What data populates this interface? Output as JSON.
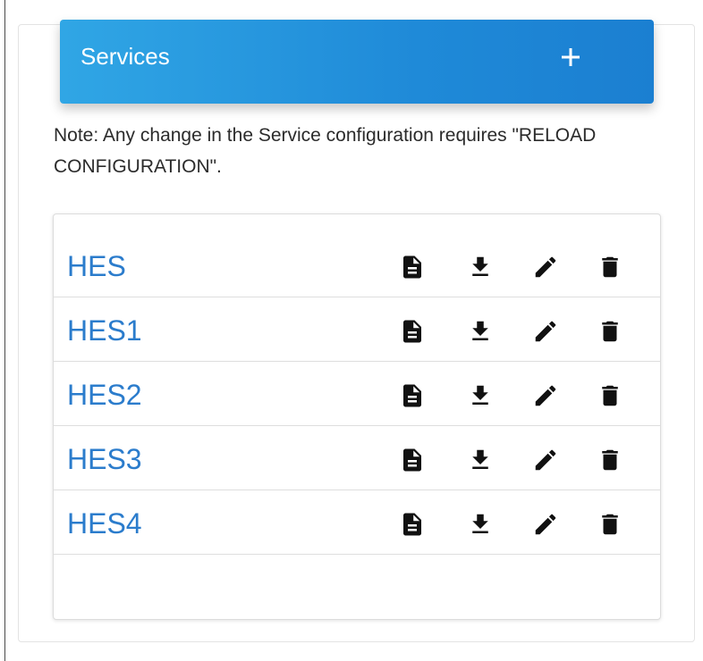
{
  "header": {
    "title": "Services",
    "add_icon": "plus-icon",
    "background": "#1f8ad8"
  },
  "note": {
    "text": "Note: Any change in the Service configuration requires \"RELOAD CONFIGURATION\"."
  },
  "services": [
    {
      "name": "HES"
    },
    {
      "name": "HES1"
    },
    {
      "name": "HES2"
    },
    {
      "name": "HES3"
    },
    {
      "name": "HES4"
    }
  ],
  "row_actions": [
    "document-icon",
    "download-icon",
    "edit-icon",
    "delete-icon"
  ],
  "colors": {
    "link": "#2b7ccc",
    "icon": "#111111"
  }
}
